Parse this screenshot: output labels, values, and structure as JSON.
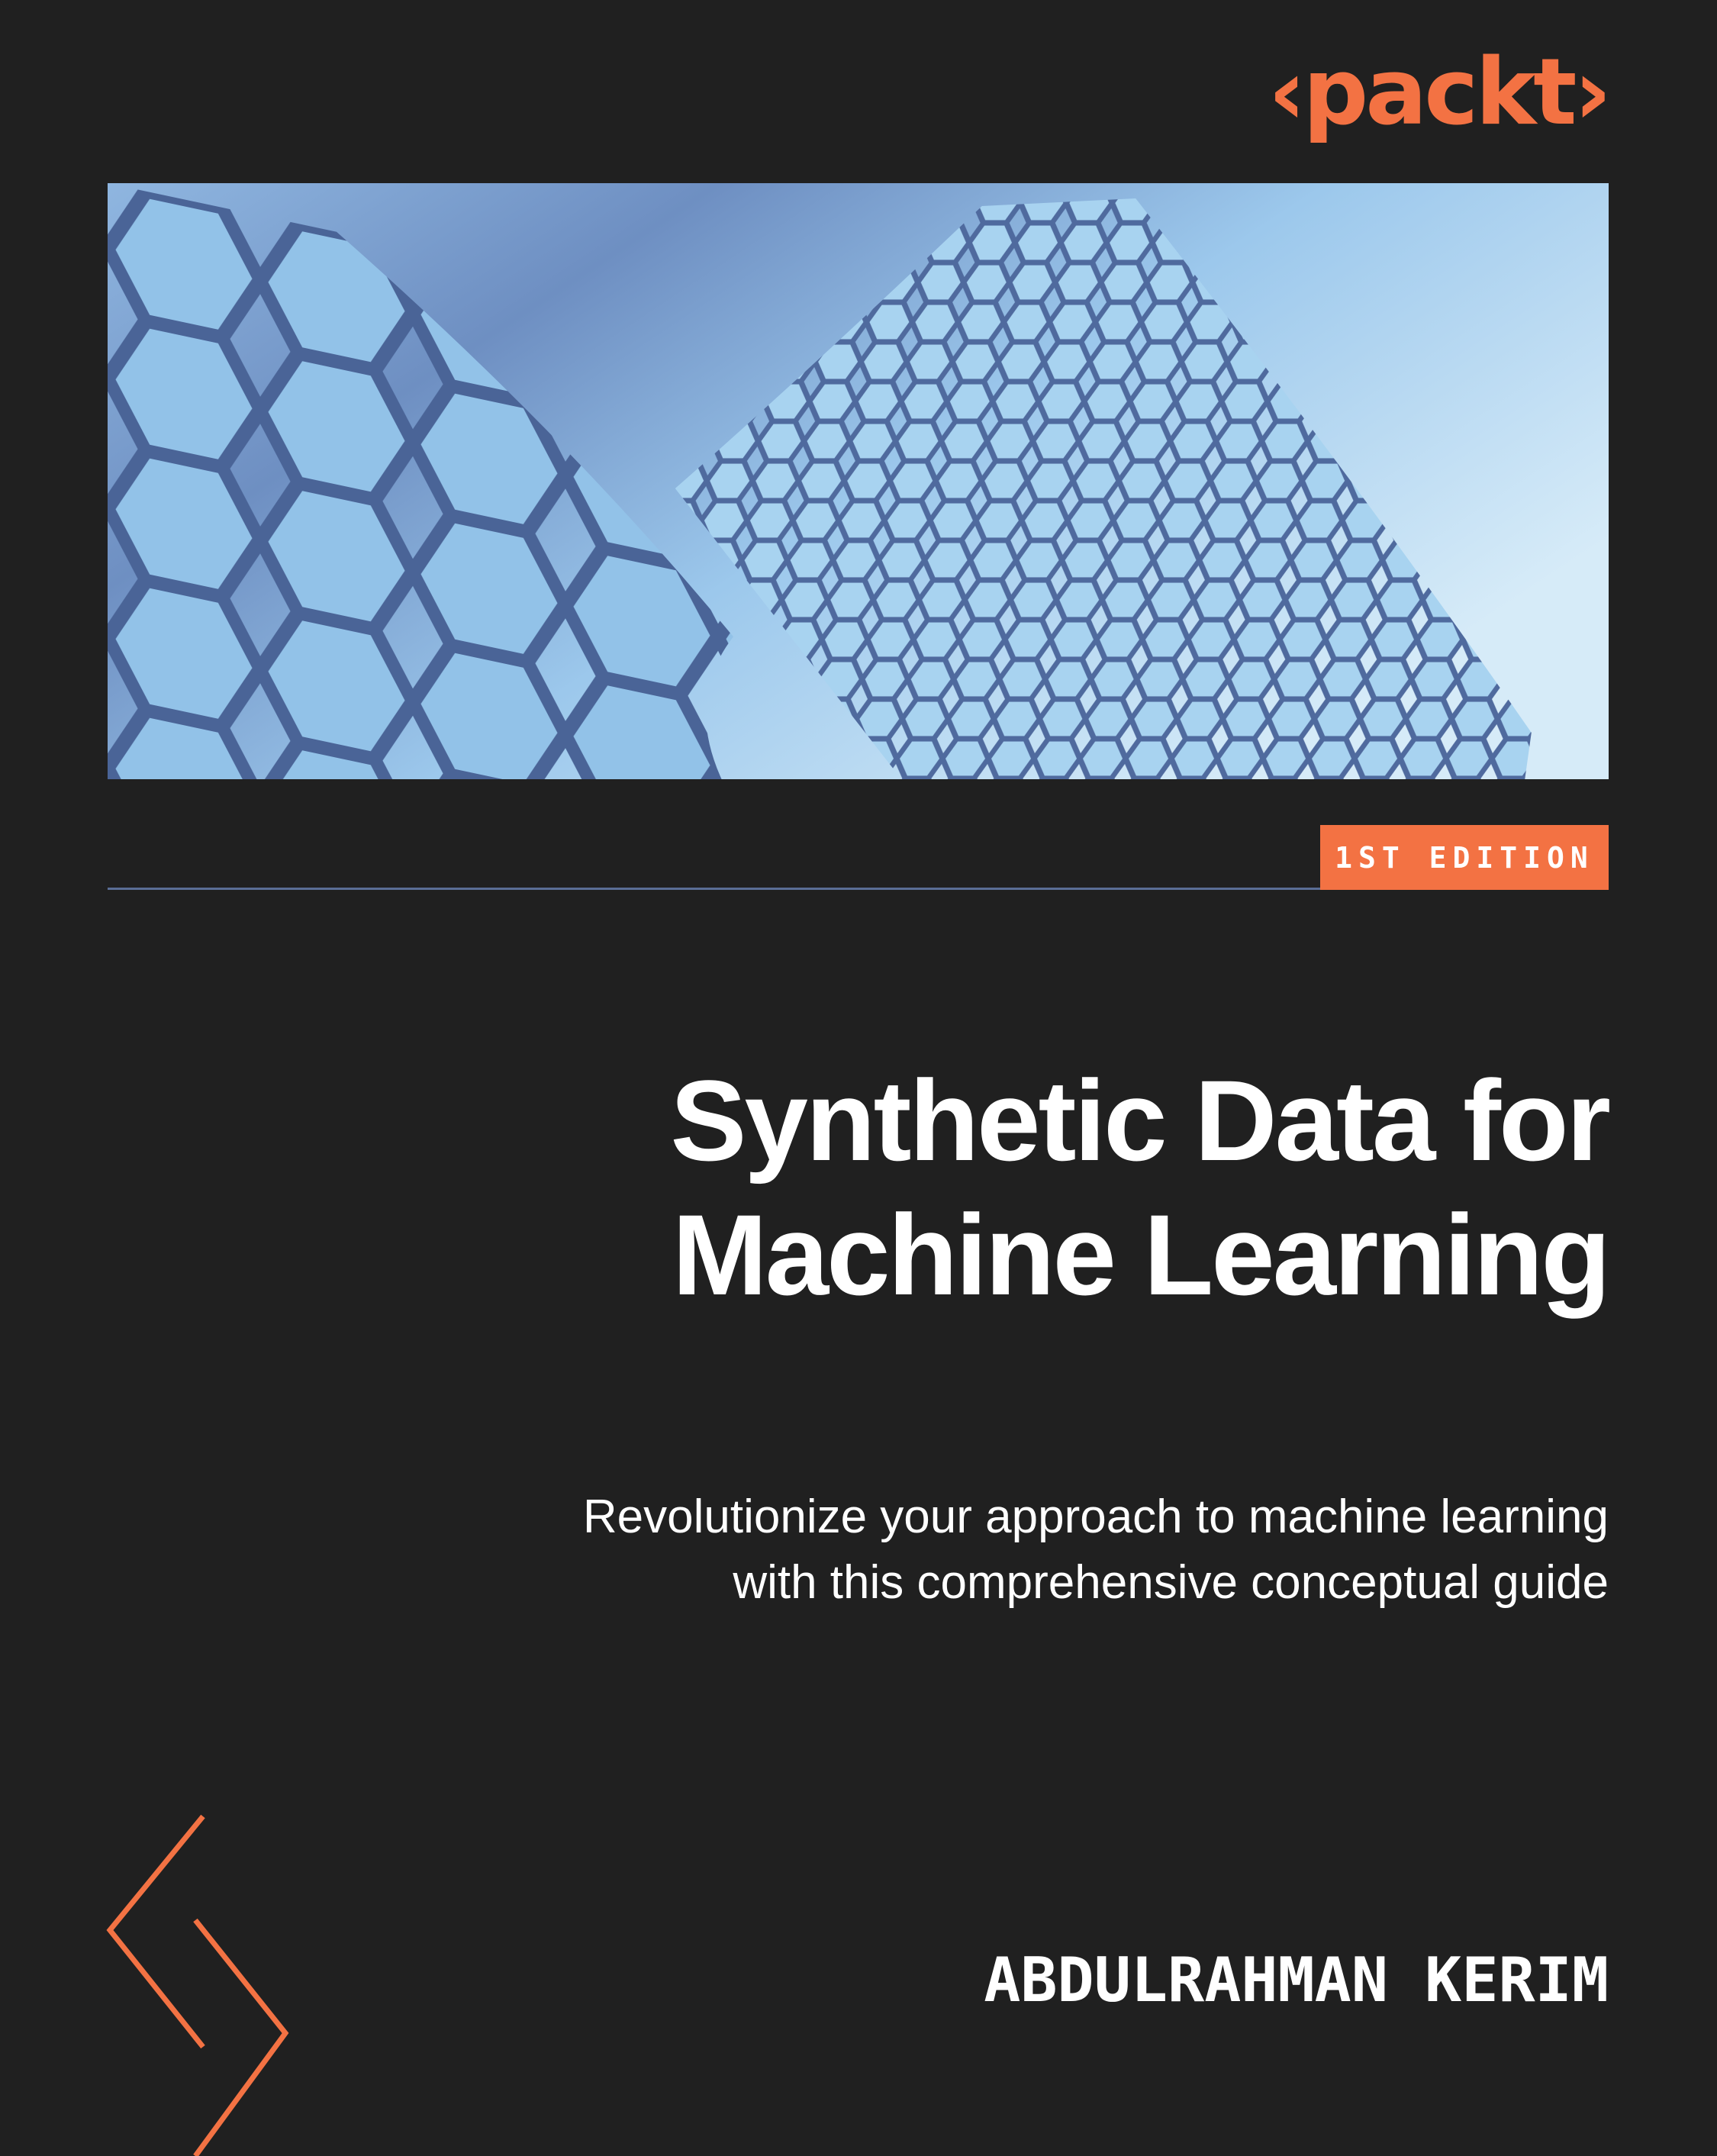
{
  "publisher": {
    "logo": "‹packt›"
  },
  "edition": {
    "label": "1ST EDITION"
  },
  "book": {
    "title_line1": "Synthetic Data for",
    "title_line2": "Machine Learning",
    "subtitle_line1": "Revolutionize your approach to machine learning",
    "subtitle_line2": "with this comprehensive conceptual guide",
    "author": "ABDULRAHMAN KERIM"
  },
  "colors": {
    "background": "#202020",
    "accent": "#f37243",
    "text": "#ffffff",
    "rule": "#5a6d95"
  },
  "icons": {
    "cover_image": "hexagon-mesh-image",
    "decoration": "chevron-icon"
  }
}
